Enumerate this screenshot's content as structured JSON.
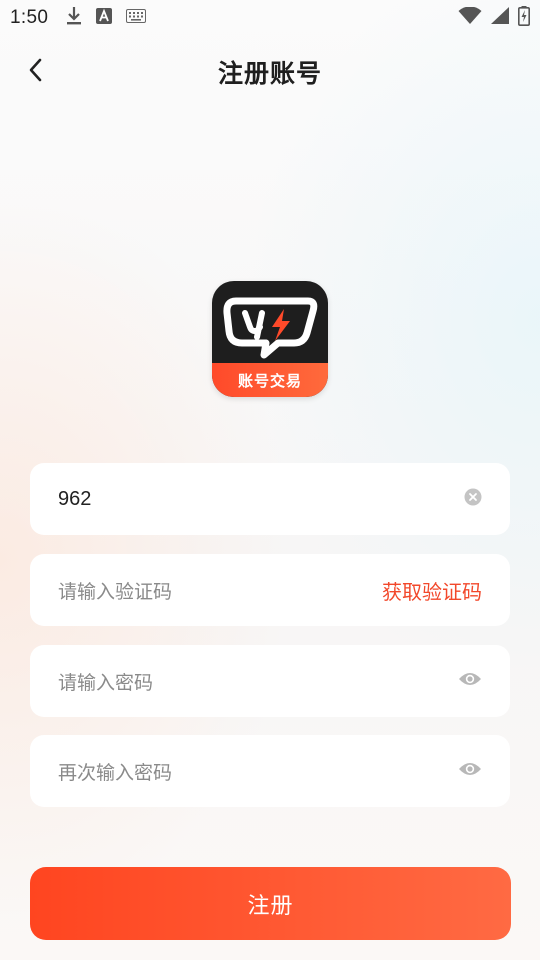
{
  "status_bar": {
    "time": "1:50",
    "left_icons": [
      "download-icon",
      "text-a-icon",
      "keyboard-icon"
    ],
    "right_icons": [
      "wifi-icon",
      "cellular-signal-icon",
      "battery-charging-icon"
    ]
  },
  "header": {
    "back_icon": "chevron-left-icon",
    "title": "注册账号"
  },
  "logo": {
    "band_text": "账号交易",
    "colors": {
      "body": "#1e1e1e",
      "band": "#ff4a2a"
    }
  },
  "form": {
    "phone": {
      "value": "962",
      "clear_icon": "clear-circle-icon"
    },
    "code": {
      "placeholder": "请输入验证码",
      "action_label": "获取验证码"
    },
    "password": {
      "placeholder": "请输入密码",
      "toggle_icon": "eye-icon"
    },
    "confirm_password": {
      "placeholder": "再次输入密码",
      "toggle_icon": "eye-icon"
    }
  },
  "submit": {
    "label": "注册"
  },
  "colors": {
    "accent": "#f2482b",
    "button_start": "#ff4520",
    "button_end": "#ff6a43"
  }
}
